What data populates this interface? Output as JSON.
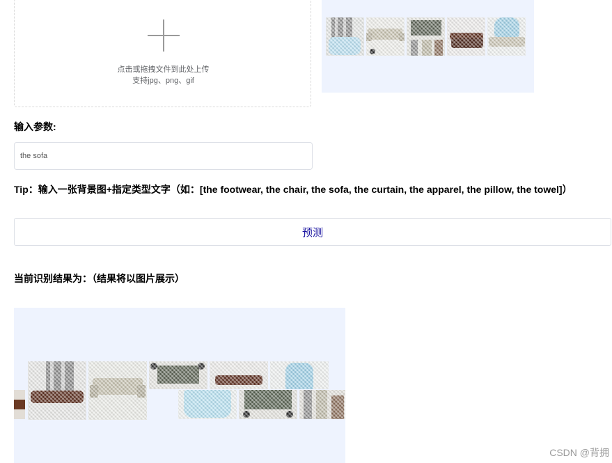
{
  "upload": {
    "line1": "点击或拖拽文件到此处上传",
    "line2": "支持jpg、png、gif",
    "icon": "plus-icon"
  },
  "params": {
    "label": "输入参数:",
    "value": "the sofa"
  },
  "tip": "Tip：输入一张背景图+指定类型文字（如：[the footwear, the chair, the sofa, the curtain, the apparel, the pillow, the towel]）",
  "predict_button": "预测",
  "result": {
    "label": "当前识别结果为：（结果将以图片展示）"
  },
  "watermark": "CSDN @背拥",
  "colors": {
    "accent_text": "#1a14a0",
    "preview_bg": "#eef3fe",
    "border": "#dcdfe6"
  }
}
